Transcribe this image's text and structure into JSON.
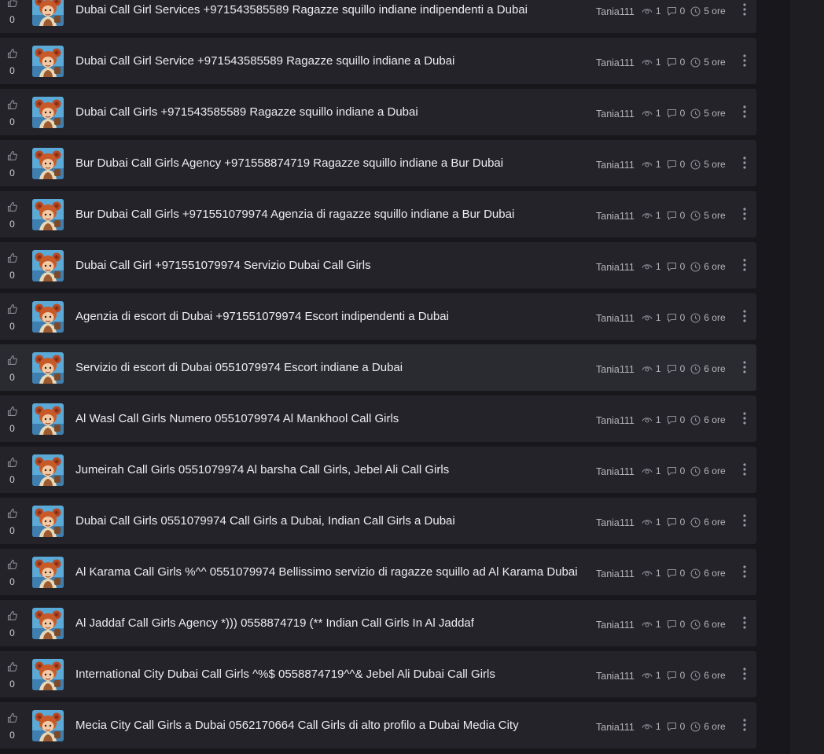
{
  "icons": {
    "like": "thumbs-up-icon",
    "views": "eye-icon",
    "comments": "comment-icon",
    "time": "clock-icon",
    "more": "more-vertical-icon"
  },
  "colors": {
    "background": "#18181c",
    "row": "#232329",
    "row_highlight": "#2a2a31",
    "title": "#ededf0",
    "meta": "#b4b4bb"
  },
  "topics": [
    {
      "votes": "0",
      "title": "Dubai Call Girl Services +971543585589 Ragazze squillo indiane indipendenti a Dubai",
      "author": "Tania111",
      "views": "1",
      "comments": "0",
      "age": "5 ore"
    },
    {
      "votes": "0",
      "title": "Dubai Call Girl Service +971543585589 Ragazze squillo indiane a Dubai",
      "author": "Tania111",
      "views": "1",
      "comments": "0",
      "age": "5 ore"
    },
    {
      "votes": "0",
      "title": "Dubai Call Girls +971543585589 Ragazze squillo indiane a Dubai",
      "author": "Tania111",
      "views": "1",
      "comments": "0",
      "age": "5 ore"
    },
    {
      "votes": "0",
      "title": "Bur Dubai Call Girls Agency +971558874719 Ragazze squillo indiane a Bur Dubai",
      "author": "Tania111",
      "views": "1",
      "comments": "0",
      "age": "5 ore"
    },
    {
      "votes": "0",
      "title": "Bur Dubai Call Girls +971551079974 Agenzia di ragazze squillo indiane a Bur Dubai",
      "author": "Tania111",
      "views": "1",
      "comments": "0",
      "age": "5 ore"
    },
    {
      "votes": "0",
      "title": "Dubai Call Girl +971551079974 Servizio Dubai Call Girls",
      "author": "Tania111",
      "views": "1",
      "comments": "0",
      "age": "6 ore"
    },
    {
      "votes": "0",
      "title": "Agenzia di escort di Dubai +971551079974 Escort indipendenti a Dubai",
      "author": "Tania111",
      "views": "1",
      "comments": "0",
      "age": "6 ore"
    },
    {
      "votes": "0",
      "title": "Servizio di escort di Dubai 0551079974 Escort indiane a Dubai",
      "author": "Tania111",
      "views": "1",
      "comments": "0",
      "age": "6 ore"
    },
    {
      "votes": "0",
      "title": "Al Wasl Call Girls Numero 0551079974 Al Mankhool Call Girls",
      "author": "Tania111",
      "views": "1",
      "comments": "0",
      "age": "6 ore"
    },
    {
      "votes": "0",
      "title": "Jumeirah Call Girls 0551079974 Al barsha Call Girls, Jebel Ali Call Girls",
      "author": "Tania111",
      "views": "1",
      "comments": "0",
      "age": "6 ore"
    },
    {
      "votes": "0",
      "title": "Dubai Call Girls 0551079974 Call Girls a Dubai, Indian Call Girls a Dubai",
      "author": "Tania111",
      "views": "1",
      "comments": "0",
      "age": "6 ore"
    },
    {
      "votes": "0",
      "title": "Al Karama Call Girls %^^ 0551079974 Bellissimo servizio di ragazze squillo ad Al Karama Dubai",
      "author": "Tania111",
      "views": "1",
      "comments": "0",
      "age": "6 ore"
    },
    {
      "votes": "0",
      "title": "Al Jaddaf Call Girls Agency *))) 0558874719 (** Indian Call Girls In Al Jaddaf",
      "author": "Tania111",
      "views": "1",
      "comments": "0",
      "age": "6 ore"
    },
    {
      "votes": "0",
      "title": "International City Dubai Call Girls ^%$ 0558874719^^& Jebel Ali Dubai Call Girls",
      "author": "Tania111",
      "views": "1",
      "comments": "0",
      "age": "6 ore"
    },
    {
      "votes": "0",
      "title": "Mecia City Call Girls a Dubai 0562170664 Call Girls di alto profilo a Dubai Media City",
      "author": "Tania111",
      "views": "1",
      "comments": "0",
      "age": "6 ore"
    }
  ]
}
